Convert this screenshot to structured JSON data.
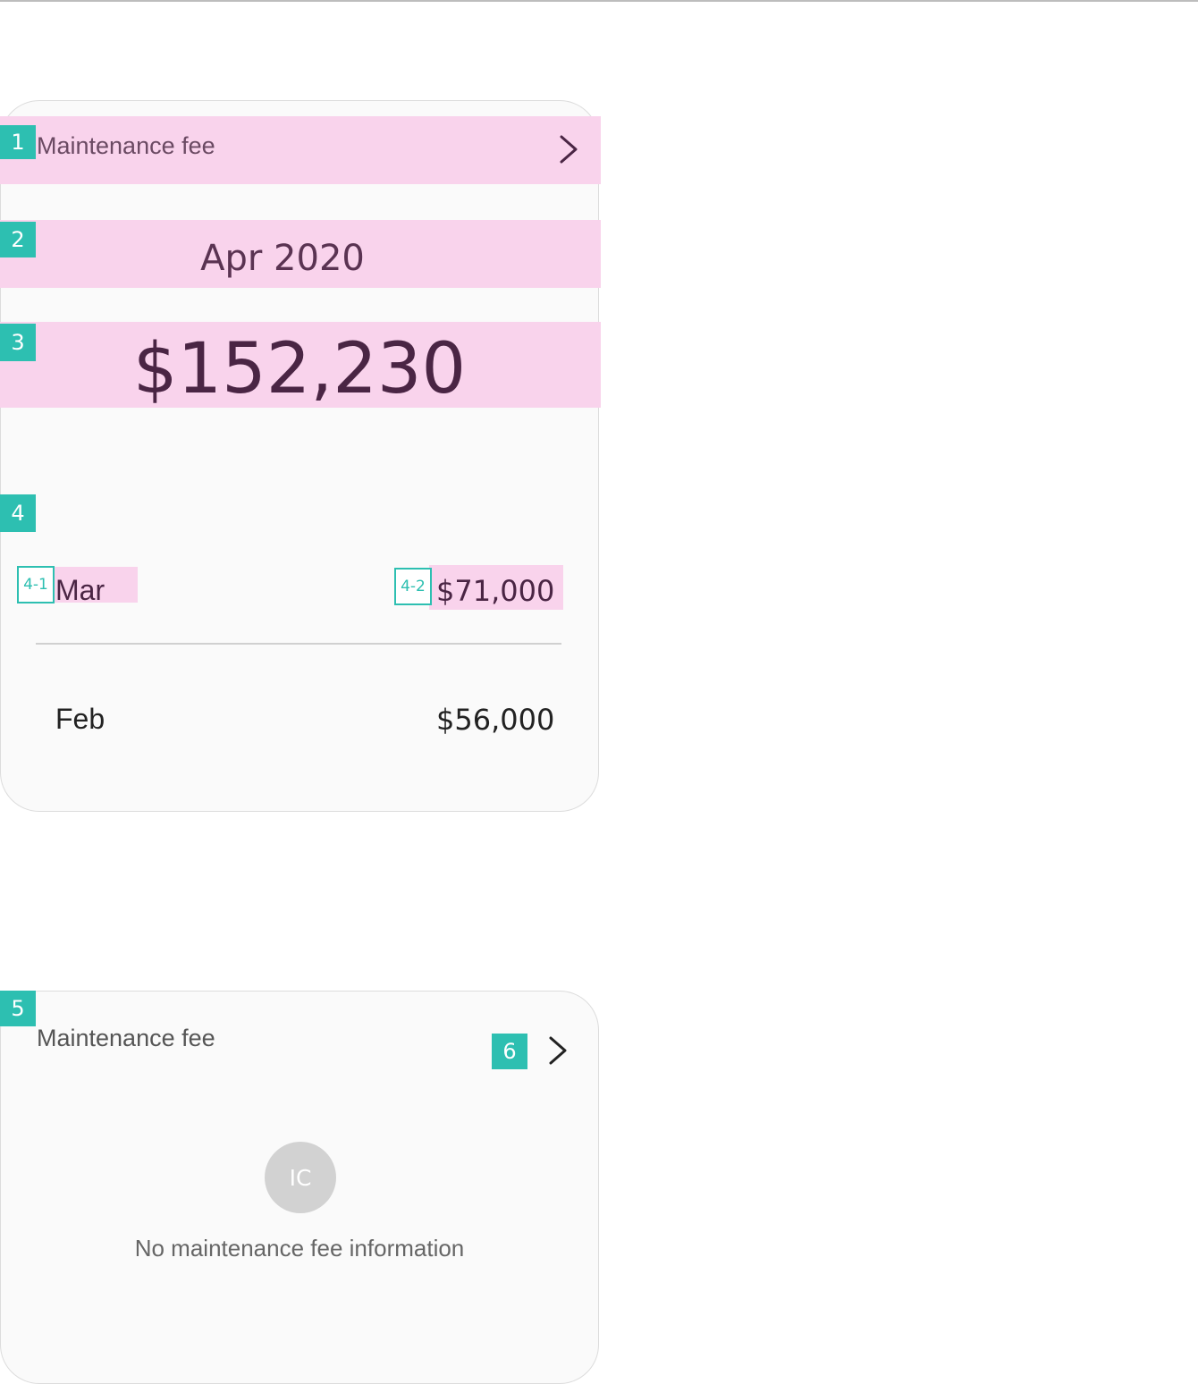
{
  "card_with_data": {
    "header_title": "Maintenance fee",
    "header_icon": "chevron-right-icon",
    "current_month": "Apr 2020",
    "current_amount": "$152,230",
    "history": [
      {
        "month": "Mar",
        "amount": "$71,000"
      },
      {
        "month": "Feb",
        "amount": "$56,000"
      }
    ]
  },
  "card_empty": {
    "header_title": "Maintenance fee",
    "header_icon": "chevron-right-icon",
    "placeholder_icon_text": "IC",
    "empty_message": "No maintenance fee information"
  },
  "annotations": {
    "b1": "1",
    "b2": "2",
    "b3": "3",
    "b4": "4",
    "b4_1": "4-1",
    "b4_2": "4-2",
    "b5": "5",
    "b6": "6"
  },
  "colors": {
    "highlight": "#f9d3ec",
    "badge": "#2dbfb1",
    "header_text": "#6b4a63",
    "amount_text": "#4a2544"
  }
}
